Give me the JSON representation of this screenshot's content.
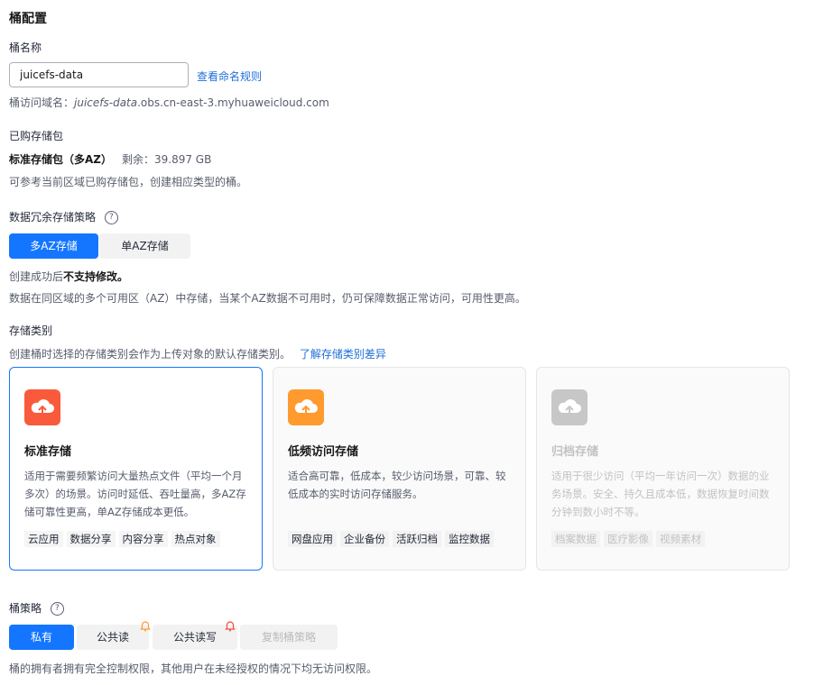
{
  "section_title": "桶配置",
  "bucket_name": {
    "label": "桶名称",
    "value": "juicefs-data",
    "naming_rules_link": "查看命名规则",
    "domain_prefix": "桶访问域名：",
    "domain_bucket": "juicefs-data",
    "domain_suffix": ".obs.cn-east-3.myhuaweicloud.com"
  },
  "storage_package": {
    "label": "已购存储包",
    "name": "标准存储包（多AZ）",
    "remaining": "剩余：39.897 GB",
    "hint": "可参考当前区域已购存储包，创建相应类型的桶。"
  },
  "redundancy": {
    "label": "数据冗余存储策略",
    "help_icon": "?",
    "options": [
      "多AZ存储",
      "单AZ存储"
    ],
    "selected": "多AZ存储",
    "note_prefix": "创建成功后",
    "note_bold": "不支持修改。",
    "description": "数据在同区域的多个可用区（AZ）中存储，当某个AZ数据不可用时，仍可保障数据正常访问，可用性更高。"
  },
  "storage_class": {
    "label": "存储类别",
    "hint": "创建桶时选择的存储类别会作为上传对象的默认存储类别。",
    "diff_link": "了解存储类别差异",
    "cards": [
      {
        "title": "标准存储",
        "icon": "cloud-upload-icon",
        "color": "#fa5a3c",
        "desc": "适用于需要频繁访问大量热点文件（平均一个月多次）的场景。访问时延低、吞吐量高，多AZ存储可靠性更高，单AZ存储成本更低。",
        "tags": [
          "云应用",
          "数据分享",
          "内容分享",
          "热点对象"
        ],
        "selected": true
      },
      {
        "title": "低频访问存储",
        "icon": "cloud-upload-icon",
        "color": "#ff9a2e",
        "desc": "适合高可靠，低成本，较少访问场景，可靠、较低成本的实时访问存储服务。",
        "tags": [
          "网盘应用",
          "企业备份",
          "活跃归档",
          "监控数据"
        ],
        "selected": false
      },
      {
        "title": "归档存储",
        "icon": "cloud-upload-icon",
        "color": "#c7c7c7",
        "desc": "适用于很少访问（平均一年访问一次）数据的业务场景。安全、持久且成本低，数据恢复时间数分钟到数小时不等。",
        "tags": [
          "档案数据",
          "医疗影像",
          "视频素材"
        ],
        "selected": false
      }
    ]
  },
  "bucket_policy": {
    "label": "桶策略",
    "help_icon": "?",
    "options": [
      "私有",
      "公共读",
      "公共读写",
      "复制桶策略"
    ],
    "selected": "私有",
    "description": "桶的拥有者拥有完全控制权限，其他用户在未经授权的情况下均无访问权限。"
  },
  "colors": {
    "primary": "#1476ff",
    "link": "#1f6fd8",
    "warning_bell_orange": "#ff9a2e",
    "warning_bell_red": "#f24c3d"
  }
}
